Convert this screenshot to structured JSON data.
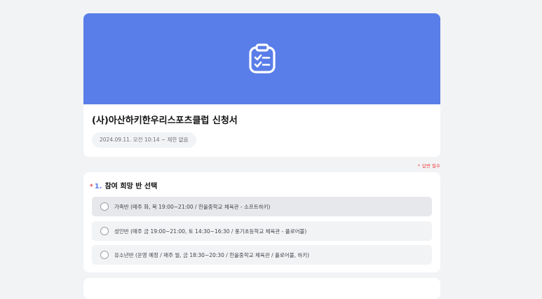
{
  "form": {
    "banner_icon": "clipboard-checklist-icon",
    "banner_color": "#5a7ee9",
    "title": "(사)아산하키한우리스포츠클럽 신청서",
    "date_range": "2024.09.11. 오전 10:14 ~ 제한 없음"
  },
  "required_note": "답변 필수",
  "question": {
    "required_mark": "*",
    "number": "1.",
    "title": "참여 희망 반 선택",
    "options": [
      {
        "label": "가족반 (매주 화, 목 19:00~21:00 / 한올중학교 체육관 - 소프트하키)"
      },
      {
        "label": "성인반 (매주 금 19:00~21:00, 토 14:30~16:30 / 풍기초등학교 체육관 - 플로어볼)"
      },
      {
        "label": "유소년반 (운영 예정 / 매주 월, 금 18:30~20:30 / 한올중학교 체육관 / 플로어볼, 하키)"
      }
    ]
  }
}
